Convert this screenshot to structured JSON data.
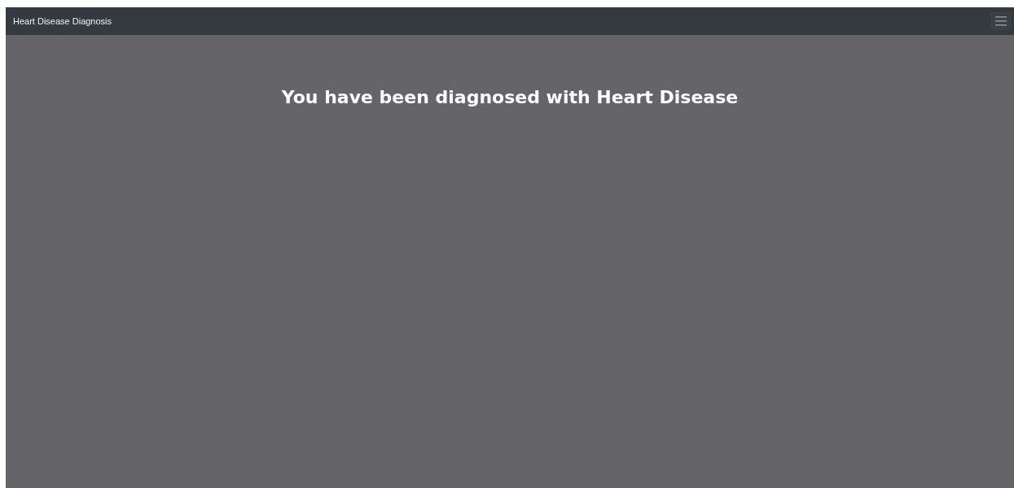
{
  "navbar": {
    "brand": "Heart Disease Diagnosis"
  },
  "result": {
    "heading": "You have been diagnosed with Heart Disease"
  }
}
